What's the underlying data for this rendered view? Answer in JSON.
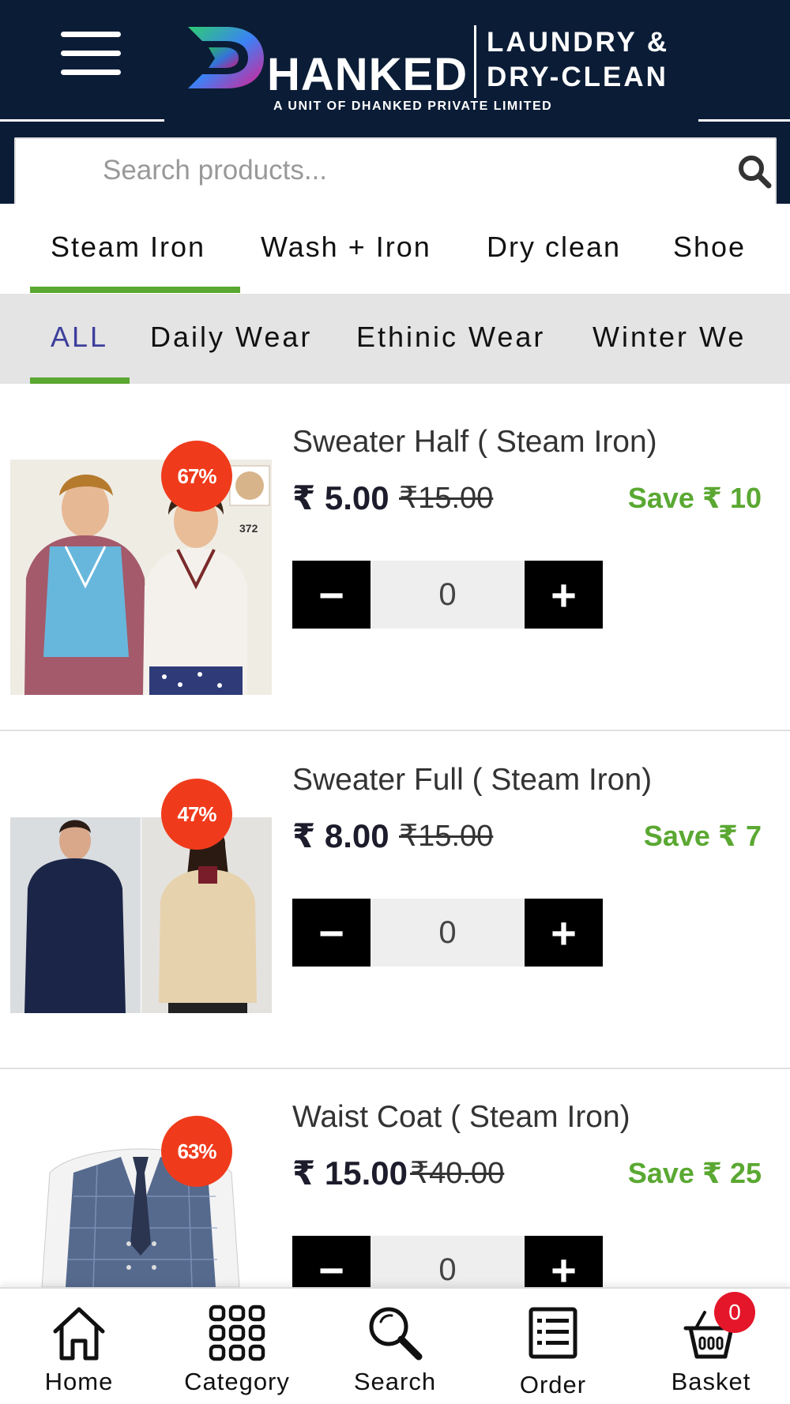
{
  "header": {
    "brand_name": "HANKED",
    "brand_right_line1": "LAUNDRY &",
    "brand_right_line2": "DRY-CLEAN",
    "brand_subtitle": "A UNIT OF DHANKED PRIVATE LIMITED",
    "background_color": "#0b1c36"
  },
  "search": {
    "placeholder": "Search products...",
    "value": ""
  },
  "service_tabs": [
    {
      "label": "Steam Iron",
      "active": true
    },
    {
      "label": "Wash + Iron",
      "active": false
    },
    {
      "label": "Dry clean",
      "active": false
    },
    {
      "label": "Shoe",
      "active": false
    }
  ],
  "category_tabs": [
    {
      "label": "ALL",
      "active": true
    },
    {
      "label": "Daily Wear",
      "active": false
    },
    {
      "label": "Ethinic Wear",
      "active": false
    },
    {
      "label": "Winter We",
      "active": false
    }
  ],
  "products": [
    {
      "name": "Sweater Half ( Steam Iron)",
      "price": "₹ 5.00",
      "mrp": "₹15.00",
      "save": "Save ₹ 10",
      "discount": "67%",
      "quantity": "0",
      "image_watermark": "372"
    },
    {
      "name": "Sweater Full ( Steam Iron)",
      "price": "₹ 8.00",
      "mrp": "₹15.00",
      "save": "Save ₹ 7",
      "discount": "47%",
      "quantity": "0"
    },
    {
      "name": "Waist Coat ( Steam Iron)",
      "price": "₹ 15.00",
      "mrp": "₹40.00",
      "save": "Save ₹ 25",
      "discount": "63%",
      "quantity": "0"
    }
  ],
  "qty_controls": {
    "minus": "−",
    "plus": "+"
  },
  "bottom_nav": [
    {
      "label": "Home",
      "icon": "home-icon"
    },
    {
      "label": "Category",
      "icon": "grid-icon"
    },
    {
      "label": "Search",
      "icon": "search-icon"
    },
    {
      "label": "Order",
      "icon": "order-list-icon"
    },
    {
      "label": "Basket",
      "icon": "basket-icon",
      "badge": "0"
    }
  ],
  "colors": {
    "accent_green": "#5aa832",
    "badge_red": "#ef3b1c",
    "active_tab_text": "#3d3f9c",
    "basket_badge": "#e4162a"
  }
}
